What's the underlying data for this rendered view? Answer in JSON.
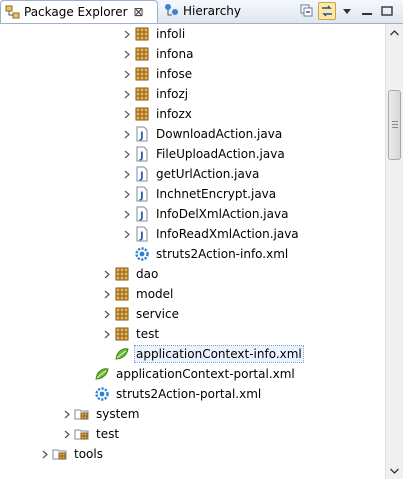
{
  "tabs": [
    {
      "label": "Package Explorer",
      "icon": "package-explorer-icon",
      "active": true,
      "close": "⊠"
    },
    {
      "label": "Hierarchy",
      "icon": "hierarchy-icon",
      "active": false
    }
  ],
  "toolbar": {
    "buttons": [
      "collapse-all-icon",
      "link-with-editor-icon"
    ]
  },
  "tree": [
    {
      "label": "infoli",
      "icon": "package-icon",
      "expander": "collapsed",
      "indent": 3
    },
    {
      "label": "infona",
      "icon": "package-icon",
      "expander": "collapsed",
      "indent": 3
    },
    {
      "label": "infose",
      "icon": "package-icon",
      "expander": "collapsed",
      "indent": 3
    },
    {
      "label": "infozj",
      "icon": "package-icon",
      "expander": "collapsed",
      "indent": 3
    },
    {
      "label": "infozx",
      "icon": "package-icon",
      "expander": "collapsed",
      "indent": 3
    },
    {
      "label": "DownloadAction.java",
      "icon": "java-file-icon",
      "expander": "collapsed",
      "indent": 3
    },
    {
      "label": "FileUploadAction.java",
      "icon": "java-file-icon",
      "expander": "collapsed",
      "indent": 3
    },
    {
      "label": "getUrlAction.java",
      "icon": "java-file-icon",
      "expander": "collapsed",
      "indent": 3
    },
    {
      "label": "InchnetEncrypt.java",
      "icon": "java-file-icon",
      "expander": "collapsed",
      "indent": 3
    },
    {
      "label": "InfoDelXmlAction.java",
      "icon": "java-file-icon",
      "expander": "collapsed",
      "indent": 3
    },
    {
      "label": "InfoReadXmlAction.java",
      "icon": "java-file-icon",
      "expander": "collapsed",
      "indent": 3
    },
    {
      "label": "struts2Action-info.xml",
      "icon": "struts-xml-icon",
      "expander": "none",
      "indent": 3
    },
    {
      "label": "dao",
      "icon": "package-icon",
      "expander": "collapsed",
      "indent": 2
    },
    {
      "label": "model",
      "icon": "package-icon",
      "expander": "collapsed",
      "indent": 2
    },
    {
      "label": "service",
      "icon": "package-icon",
      "expander": "collapsed",
      "indent": 2
    },
    {
      "label": "test",
      "icon": "package-icon",
      "expander": "collapsed",
      "indent": 2
    },
    {
      "label": "applicationContext-info.xml",
      "icon": "spring-xml-icon",
      "expander": "none",
      "indent": 2,
      "selected": true
    },
    {
      "label": "applicationContext-portal.xml",
      "icon": "spring-xml-icon",
      "expander": "none",
      "indent": 1
    },
    {
      "label": "struts2Action-portal.xml",
      "icon": "struts-xml-icon",
      "expander": "none",
      "indent": 1
    },
    {
      "label": "system",
      "icon": "folder-package-icon",
      "expander": "collapsed",
      "indent": 0
    },
    {
      "label": "test",
      "icon": "folder-package-icon",
      "expander": "collapsed",
      "indent": 0
    },
    {
      "label": "tools",
      "icon": "folder-package-icon",
      "expander": "collapsed",
      "indent": -1
    }
  ],
  "colors": {
    "selection": "#eaf3fd",
    "tab_border": "#9db1cc",
    "package": "#c8881c",
    "java": "#2f5fa8",
    "spring": "#6dbb2f",
    "struts": "#2a7fd0"
  }
}
